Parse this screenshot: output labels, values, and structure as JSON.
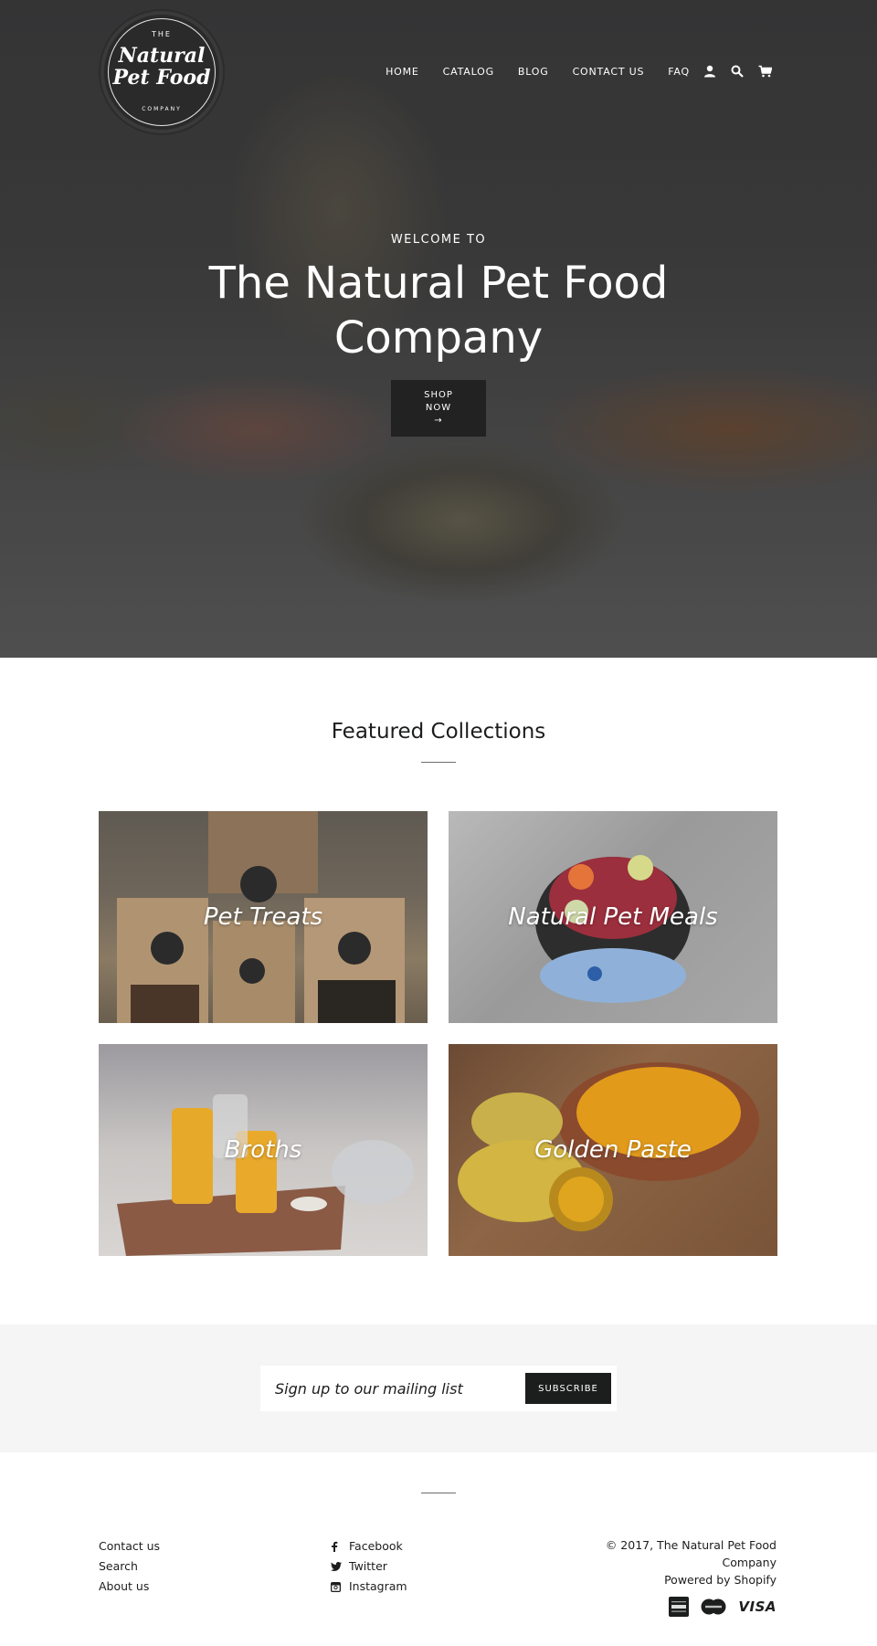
{
  "header": {
    "logo": {
      "top": "THE",
      "name_line1": "Natural",
      "name_line2": "Pet Food",
      "bottom": "COMPANY"
    },
    "nav": [
      "HOME",
      "CATALOG",
      "BLOG",
      "CONTACT US",
      "FAQ"
    ],
    "icons": [
      "account-icon",
      "search-icon",
      "cart-icon"
    ]
  },
  "hero": {
    "pretitle": "WELCOME TO",
    "title": "The Natural Pet Food Company",
    "button": "SHOP NOW",
    "button_arrow": "→"
  },
  "featured": {
    "title": "Featured Collections",
    "collections": [
      "Pet Treats",
      "Natural Pet Meals",
      "Broths",
      "Golden Paste"
    ]
  },
  "newsletter": {
    "placeholder": "Sign up to our mailing list",
    "button": "SUBSCRIBE"
  },
  "footer": {
    "links": [
      "Contact us",
      "Search",
      "About us"
    ],
    "social": [
      "Facebook",
      "Twitter",
      "Instagram"
    ],
    "copyright_line1": "© 2017, The Natural Pet Food",
    "copyright_line2": "Company",
    "powered": "Powered by Shopify",
    "payments": [
      "american-express-icon",
      "mastercard-icon",
      "visa-icon"
    ],
    "visa_text": "VISA"
  },
  "colors": {
    "dark": "#1c1d1d",
    "newsletter_bg": "#f5f5f5",
    "hero_overlay": "#3b3b3c"
  }
}
